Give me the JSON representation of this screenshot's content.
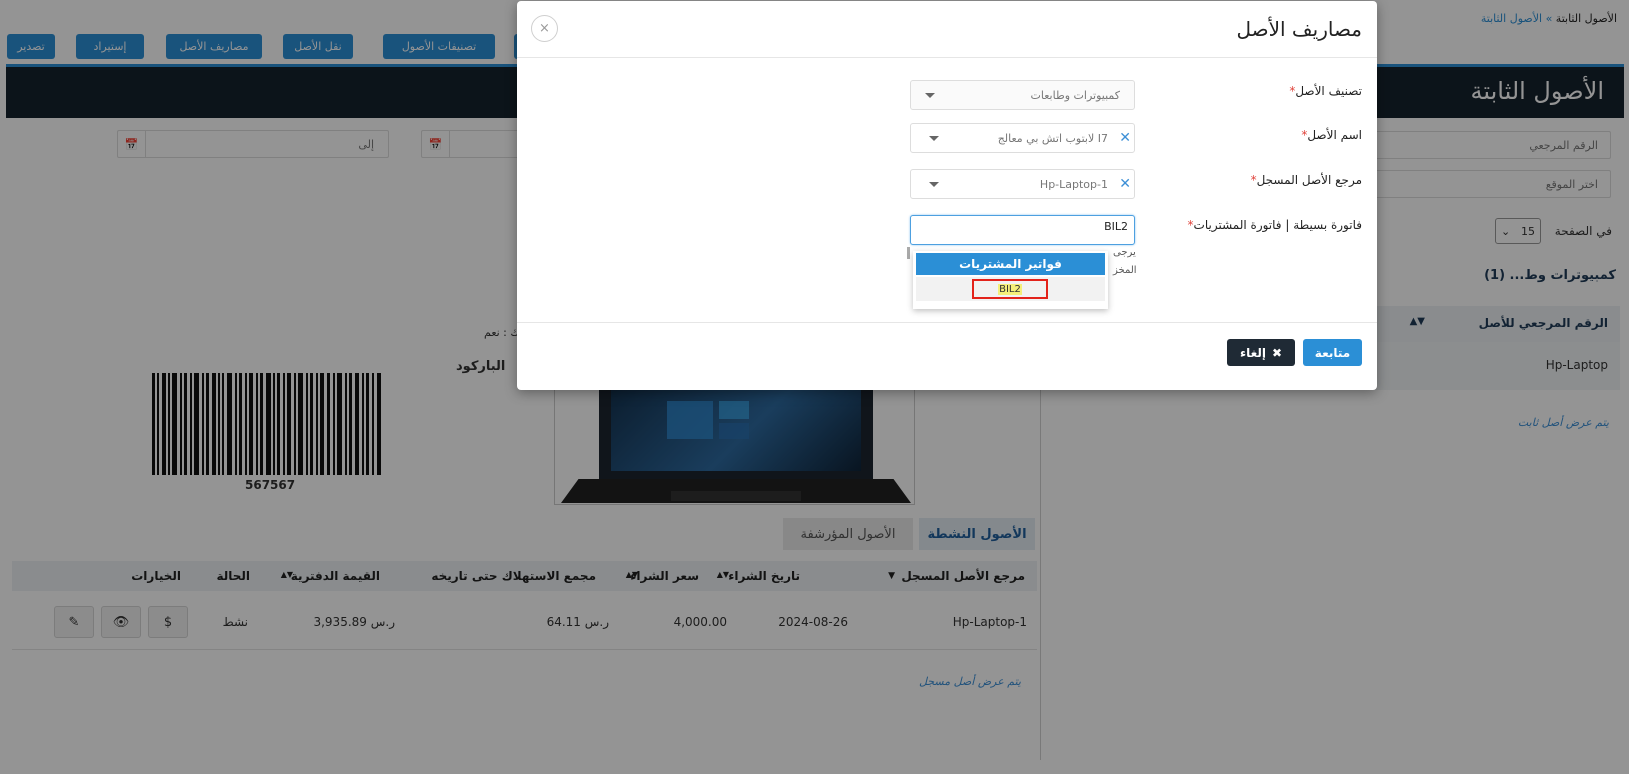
{
  "toolbar": {
    "buttons": [
      "تصدير",
      "إستيراد",
      "مصاريف الأصل",
      "نقل الأصل",
      "تصنيفات الأصول"
    ]
  },
  "breadcrumb": {
    "home": "الأصول الثابتة",
    "sep": "»",
    "current": "الأصول الثابتة"
  },
  "page": {
    "title": "الأصول الثابتة",
    "to_placeholder": "إلى",
    "ref_placeholder": "الرقم المرجعي",
    "location_placeholder": "اختر الموقع",
    "per_page_label": "في الصفحة",
    "per_page_value": "15",
    "group_title": "كمبيوترات وط... (1)",
    "list_header": "الرقم المرجعي للأصل",
    "list_item": "Hp-Laptop",
    "list_footer": "يتم عرض أصل ثابت",
    "depreciable": "يهلك : نعم",
    "barcode_label": "الباركود",
    "barcode_number": "567567"
  },
  "tabs": {
    "active": "الأصول النشطة",
    "archived": "الأصول المؤرشفة"
  },
  "table": {
    "headers": [
      "مرجع الأصل المسجل",
      "تاريخ الشراء",
      "سعر الشراء",
      "مجمع الاستهلاك حتى تاريخه",
      "القيمة الدفترية",
      "الحالة",
      "الخيارات"
    ],
    "row": [
      "Hp-Laptop-1",
      "2024-08-26",
      "4,000.00",
      "64.11 ر.س",
      "3,935.89 ر.س",
      "نشط"
    ],
    "footer": "يتم عرض أصل مسجل"
  },
  "modal": {
    "title": "مصاريف الأصل",
    "close_glyph": "×",
    "required_mark": "*",
    "labels": {
      "category": "تصنيف الأصل",
      "name": "اسم الأصل",
      "reference": "مرجع الأصل المسجل",
      "invoice": "فاتورة بسيطة | فاتورة المشتريات"
    },
    "values": {
      "category": "كمبيوترات وطابعات",
      "name": "لابتوب اتش بي معالج I7",
      "reference": "Hp-Laptop-1",
      "invoice_search": "BIL2"
    },
    "hint_fragments": [
      "يرجى",
      "المخز"
    ],
    "dropdown": {
      "group": "فواتير المشتريات",
      "option": "BIL2"
    },
    "buttons": {
      "continue": "متابعة",
      "cancel": "إلغاء"
    }
  },
  "colors": {
    "accent": "#2b8fd6",
    "dark": "#16232e",
    "highlight": "#e3231b"
  }
}
